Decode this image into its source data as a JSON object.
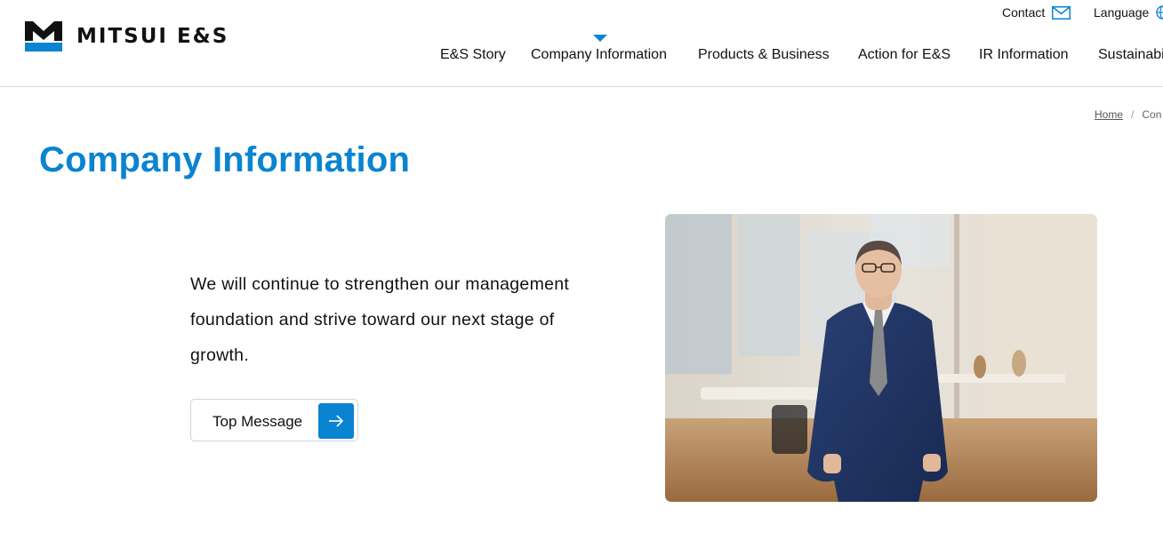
{
  "brand": {
    "name": "MITSUI E&S",
    "colors": {
      "accent": "#0a84d0",
      "logo_dark": "#111111",
      "logo_blue": "#0a84d0"
    }
  },
  "utility": {
    "contact_label": "Contact",
    "contact_icon": "mail-icon",
    "language_label": "Language",
    "language_icon": "globe-icon"
  },
  "nav": {
    "items": [
      {
        "label": "E&S Story"
      },
      {
        "label": "Company Information",
        "active": true
      },
      {
        "label": "Products & Business"
      },
      {
        "label": "Action for E&S"
      },
      {
        "label": "IR Information"
      },
      {
        "label": "Sustainabi"
      }
    ]
  },
  "breadcrumb": {
    "home": "Home",
    "separator": "/",
    "current": "Con"
  },
  "page": {
    "title": "Company Information",
    "lead": "We will continue to strengthen our management foundation and strive toward our next stage of growth.",
    "cta_label": "Top Message",
    "cta_icon": "arrow-right-icon",
    "photo_name": "executive-portrait-photo"
  }
}
